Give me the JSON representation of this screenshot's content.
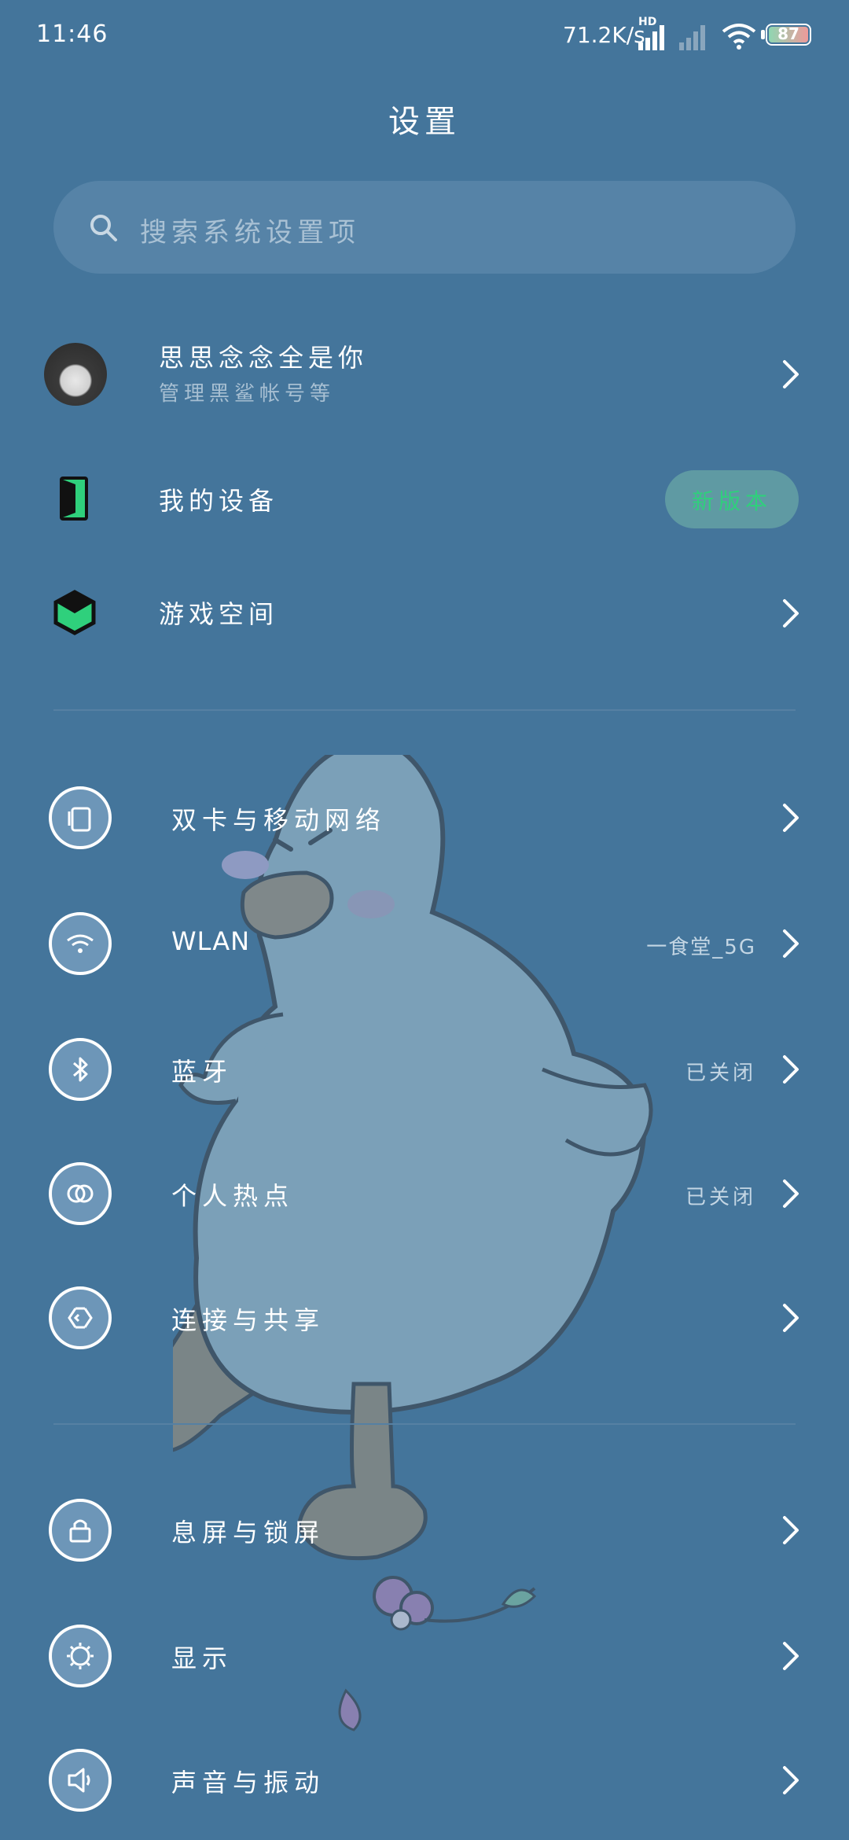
{
  "status_bar": {
    "time": "11:46",
    "net_speed": "71.2K/s",
    "signal_tag": "HD",
    "battery_level": "87"
  },
  "header": {
    "title": "设置"
  },
  "search": {
    "placeholder": "搜索系统设置项"
  },
  "account": {
    "name": "思思念念全是你",
    "subtitle": "管理黑鲨帐号等"
  },
  "device": {
    "label": "我的设备",
    "badge": "新版本"
  },
  "game_space": {
    "label": "游戏空间"
  },
  "network_items": [
    {
      "label": "双卡与移动网络",
      "icon": "sim-card-icon",
      "value": ""
    },
    {
      "label": "WLAN",
      "icon": "wifi-icon",
      "value": "一食堂_5G"
    },
    {
      "label": "蓝牙",
      "icon": "bluetooth-icon",
      "value": "已关闭"
    },
    {
      "label": "个人热点",
      "icon": "hotspot-icon",
      "value": "已关闭"
    },
    {
      "label": "连接与共享",
      "icon": "connection-share-icon",
      "value": ""
    }
  ],
  "system_items": [
    {
      "label": "息屏与锁屏",
      "icon": "lock-icon"
    },
    {
      "label": "显示",
      "icon": "display-icon"
    },
    {
      "label": "声音与振动",
      "icon": "sound-icon"
    }
  ],
  "colors": {
    "background": "#44759b",
    "accent_green": "#2fd07c",
    "badge_bg": "#5f9aa3"
  }
}
